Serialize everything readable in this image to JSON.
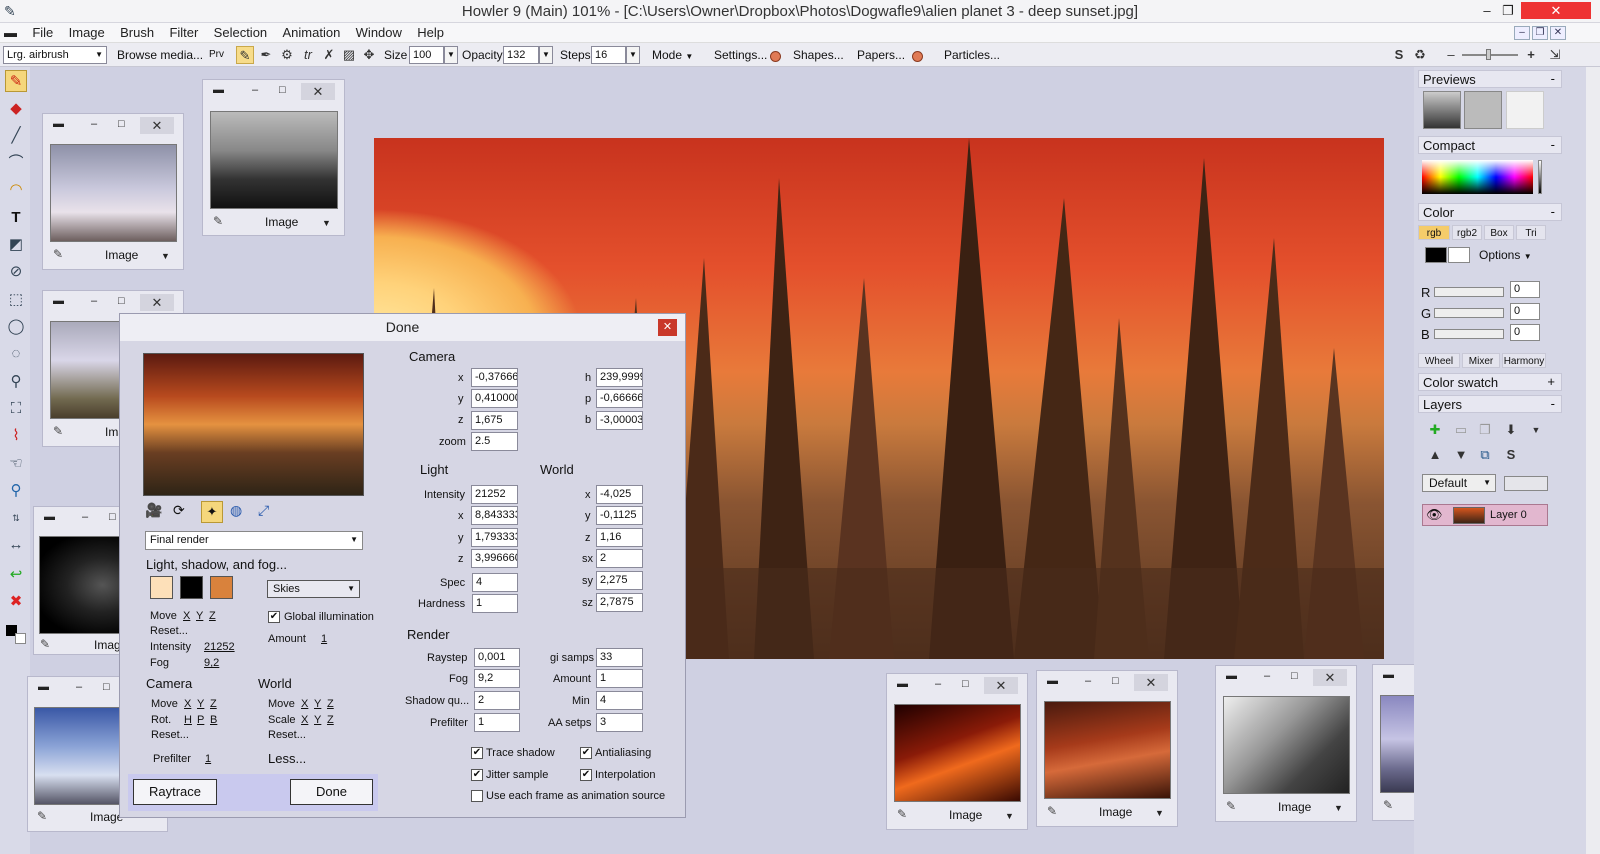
{
  "app": {
    "title": "Howler 9  (Main)   101%   - [C:\\Users\\Owner\\Dropbox\\Photos\\Dogwafle9\\alien planet 3 - deep sunset.jpg]"
  },
  "menu": [
    "File",
    "Image",
    "Brush",
    "Filter",
    "Selection",
    "Animation",
    "Window",
    "Help"
  ],
  "toolbar": {
    "brush": "Lrg. airbrush",
    "browse": "Browse media...",
    "prv": "Prv",
    "size_label": "Size",
    "size_value": "100",
    "opacity_label": "Opacity",
    "opacity_value": "132",
    "steps_label": "Steps",
    "steps_value": "16",
    "mode_label": "Mode",
    "settings": "Settings...",
    "shapes": "Shapes...",
    "papers": "Papers...",
    "particles": "Particles..."
  },
  "panel_label": "Image",
  "dialog": {
    "title": "Done",
    "render_mode": "Final render",
    "light_heading": "Light, shadow, and fog...",
    "sky_select": "Skies",
    "global_illum": "Global illumination",
    "amount_label": "Amount",
    "amount_value": "1",
    "move_label": "Move",
    "reset_label": "Reset...",
    "x": "X",
    "y": "Y",
    "z": "Z",
    "h": "H",
    "p": "P",
    "b": "B",
    "intensity_label": "Intensity",
    "intensity_value": "21252",
    "fog_label": "Fog",
    "fog_value": "9,2",
    "camera_heading": "Camera",
    "world_heading": "World",
    "rot_label": "Rot.",
    "scale_label": "Scale",
    "prefilter_label": "Prefilter",
    "prefilter_value": "1",
    "less_label": "Less...",
    "raytrace_btn": "Raytrace",
    "done_btn": "Done",
    "camera": {
      "heading": "Camera",
      "x_lbl": "x",
      "x": "-0,37666",
      "y_lbl": "y",
      "y": "0,410000",
      "z_lbl": "z",
      "z": "1,675",
      "zoom_lbl": "zoom",
      "zoom": "2.5",
      "h_lbl": "h",
      "h": "239,9999",
      "p_lbl": "p",
      "p": "-0,66666",
      "b_lbl": "b",
      "b": "-3,00003"
    },
    "light": {
      "heading": "Light",
      "intensity_lbl": "Intensity",
      "intensity": "21252",
      "x_lbl": "x",
      "x": "8,843333",
      "y_lbl": "y",
      "y": "1,793333",
      "z_lbl": "z",
      "z": "3,996660",
      "spec_lbl": "Spec",
      "spec": "4",
      "hardness_lbl": "Hardness",
      "hardness": "1"
    },
    "world": {
      "heading": "World",
      "x_lbl": "x",
      "x": "-4,025",
      "y_lbl": "y",
      "y": "-0,1125",
      "z_lbl": "z",
      "z": "1,16",
      "sx_lbl": "sx",
      "sx": "2",
      "sy_lbl": "sy",
      "sy": "2,275",
      "sz_lbl": "sz",
      "sz": "2,7875"
    },
    "render": {
      "heading": "Render",
      "raystep_lbl": "Raystep",
      "raystep": "0,001",
      "fog_lbl": "Fog",
      "fog": "9,2",
      "shadowq_lbl": "Shadow qu...",
      "shadowq": "2",
      "prefilter_lbl": "Prefilter",
      "prefilter": "1",
      "gisamps_lbl": "gi samps",
      "gisamps": "33",
      "amount_lbl": "Amount",
      "amount": "1",
      "min_lbl": "Min",
      "min": "4",
      "aa_lbl": "AA setps",
      "aa": "3"
    },
    "checks": {
      "trace_shadow": "Trace shadow",
      "antialiasing": "Antialiasing",
      "jitter": "Jitter sample",
      "interpolation": "Interpolation",
      "anim_source": "Use each frame as animation source"
    },
    "swatches": [
      "#fde0b9",
      "#000000",
      "#d9823c"
    ]
  },
  "right": {
    "previews": "Previews",
    "compact": "Compact",
    "color": "Color",
    "color_tabs": [
      "rgb",
      "rgb2",
      "Box",
      "Tri"
    ],
    "options": "Options",
    "r": "R",
    "g": "G",
    "b": "B",
    "r_val": "0",
    "g_val": "0",
    "b_val": "0",
    "mix_tabs": [
      "Wheel",
      "Mixer",
      "Harmony"
    ],
    "swatch": "Color swatch",
    "layers": "Layers",
    "layer_mode": "Default",
    "layer_name": "Layer 0",
    "minus": "-",
    "plus": "+"
  }
}
